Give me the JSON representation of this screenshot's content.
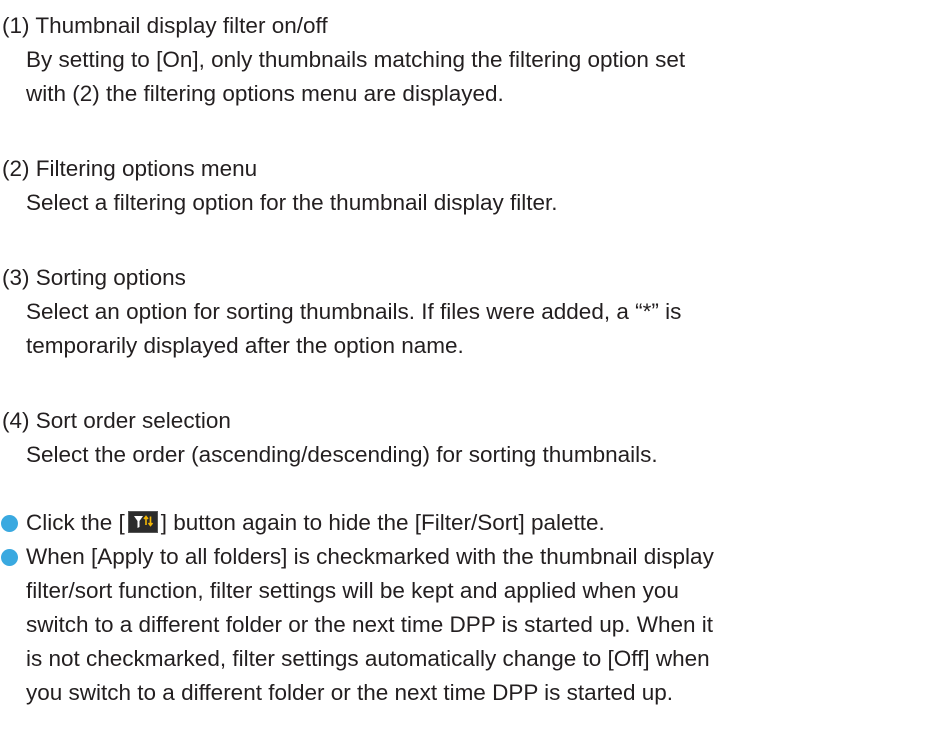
{
  "items": [
    {
      "heading": "(1) Thumbnail display filter on/off",
      "desc": [
        "By setting to [On], only thumbnails matching the filtering option set",
        "with (2) the filtering options menu are displayed."
      ]
    },
    {
      "heading": "(2) Filtering options menu",
      "desc": [
        "Select a filtering option for the thumbnail display filter."
      ]
    },
    {
      "heading": "(3) Sorting options",
      "desc": [
        "Select an option for sorting thumbnails. If files were added, a “*” is",
        "temporarily displayed after the option name."
      ]
    },
    {
      "heading": "(4) Sort order selection",
      "desc": [
        "Select the order (ascending/descending) for sorting thumbnails."
      ]
    }
  ],
  "notes": {
    "note1": {
      "before": "Click the [",
      "icon": "filter-sort-icon",
      "after": "] button again to hide the [Filter/Sort] palette."
    },
    "note2": [
      "When [Apply to all folders] is checkmarked with the thumbnail display",
      "filter/sort function, filter settings will be kept and applied when you",
      "switch to a different folder or the next time DPP is started up. When it",
      "is not checkmarked, filter settings automatically change to [Off] when",
      "you switch to a different folder or the next time DPP is started up."
    ]
  },
  "colors": {
    "text": "#231f20",
    "bullet": "#3aa9e0",
    "icon_bg": "#2b2b2b",
    "icon_glyph": "#ffffff",
    "icon_arrows": "#f2b705"
  }
}
